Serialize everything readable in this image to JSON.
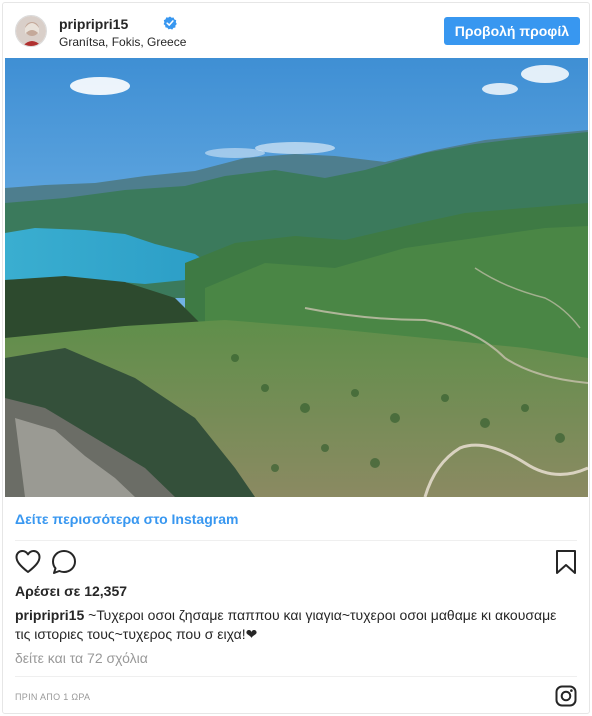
{
  "header": {
    "username": "pripripri15",
    "location": "Granítsa, Fokis, Greece",
    "profile_button": "Προβολή προφίλ",
    "verified_icon": "verified-badge-icon",
    "verified_color": "#3897f0"
  },
  "post": {
    "more_link": "Δείτε περισσότερα στο Instagram",
    "likes": "Αρέσει σε 12,357",
    "caption_user": "pripripri15",
    "caption_text": " ~Τυχεροι οσοι ζησαμε παππου και γιαγια~τυχεροι οσοι μαθαμε κι ακουσαμε τις ιστοριες τους~τυχερος που σ ειχα!❤",
    "view_comments": "δείτε και τα 72 σχόλια",
    "timestamp": "ΠΡΙΝ ΑΠΟ 1 ΩΡΑ"
  },
  "icons": {
    "like": "heart-icon",
    "comment": "comment-icon",
    "save": "bookmark-icon",
    "brand": "instagram-logo-icon"
  },
  "colors": {
    "accent": "#3897f0",
    "text": "#262626",
    "muted": "#999999",
    "border": "#e6e6e6"
  }
}
